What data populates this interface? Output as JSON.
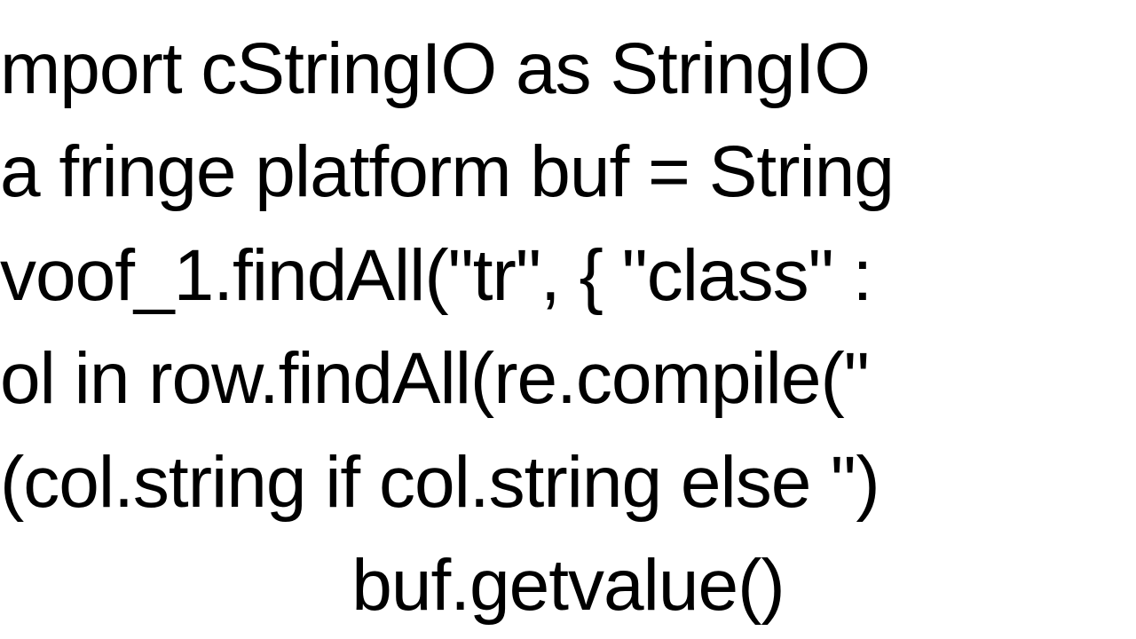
{
  "code": {
    "line1": "mport cStringIO as StringIO",
    "line2": "a fringe platform buf = String",
    "line3": "voof_1.findAll(\"tr\", { \"class\" :",
    "line4": "ol in row.findAll(re.compile(\"",
    "line5": "(col.string if col.string else '')",
    "line6": "buf.getvalue()"
  }
}
